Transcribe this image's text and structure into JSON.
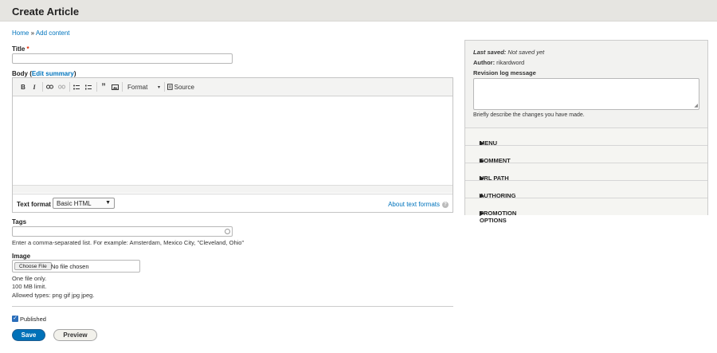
{
  "page": {
    "title": "Create Article"
  },
  "breadcrumb": {
    "home": "Home",
    "separator": "»",
    "current": "Add content"
  },
  "title_field": {
    "label": "Title",
    "required_mark": "*",
    "value": ""
  },
  "body_field": {
    "label": "Body",
    "edit_summary_open": "(",
    "edit_summary": "Edit summary",
    "edit_summary_close": ")"
  },
  "toolbar": {
    "bold": "B",
    "italic": "I",
    "link_icon": "link-icon",
    "unlink_icon": "unlink-icon",
    "bulleted_list_icon": "bulleted-list-icon",
    "numbered_list_icon": "numbered-list-icon",
    "blockquote": "”",
    "image_icon": "image-icon",
    "format": "Format",
    "source": "Source"
  },
  "text_format": {
    "label": "Text format",
    "selected": "Basic HTML",
    "about": "About text formats"
  },
  "tags": {
    "label": "Tags",
    "value": "",
    "description": "Enter a comma-separated list. For example: Amsterdam, Mexico City, \"Cleveland, Ohio\""
  },
  "image": {
    "label": "Image",
    "choose_button": "Choose File",
    "status": "No file chosen",
    "desc_lines": [
      "One file only.",
      "100 MB limit.",
      "Allowed types: png gif jpg jpeg."
    ]
  },
  "published": {
    "label": "Published",
    "checked": true
  },
  "actions": {
    "save": "Save",
    "preview": "Preview"
  },
  "sidebar": {
    "last_saved_label": "Last saved:",
    "last_saved_value": "Not saved yet",
    "author_label": "Author:",
    "author_value": "rikardword",
    "revision_label": "Revision log message",
    "revision_value": "",
    "revision_desc": "Briefly describe the changes you have made.",
    "sections": [
      "MENU SETTINGS",
      "COMMENT SETTINGS",
      "URL PATH SETTINGS",
      "AUTHORING INFORMATION",
      "PROMOTION OPTIONS"
    ],
    "section_marker": "▶"
  },
  "colors": {
    "accent": "#0071b8",
    "link": "#0074bd",
    "required": "#e32700",
    "header_bg": "#e6e5e1"
  }
}
